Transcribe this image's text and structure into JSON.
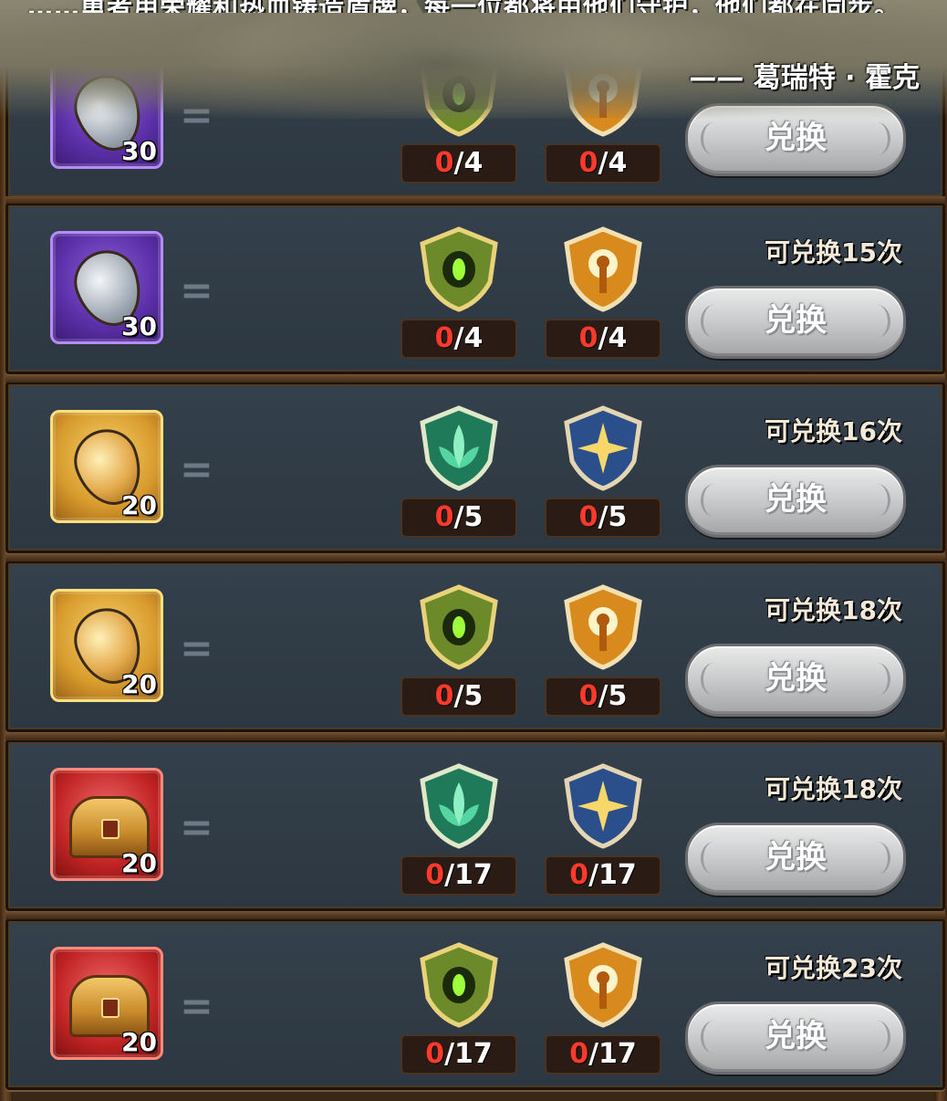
{
  "banner": {
    "quote_line": "……勇者用荣耀和热血铸造盾牌，每一位都将由他们守护，他们都在同步。",
    "quote_author": "—— 葛瑞特 · 霍克"
  },
  "rows": [
    {
      "reward_type": "purple-silver-gem",
      "reward_qty": "30",
      "item1": "0/4",
      "item1_have": "0",
      "item1_need": "/4",
      "item2_have": "0",
      "item2_need": "/4",
      "limit": "",
      "button": "兑换"
    },
    {
      "reward_type": "purple-silver-gem",
      "reward_qty": "30",
      "item1_have": "0",
      "item1_need": "/4",
      "item2_have": "0",
      "item2_need": "/4",
      "limit": "可兑换15次",
      "button": "兑换"
    },
    {
      "reward_type": "gold-gem",
      "reward_qty": "20",
      "item1_have": "0",
      "item1_need": "/5",
      "item2_have": "0",
      "item2_need": "/5",
      "limit": "可兑换16次",
      "button": "兑换"
    },
    {
      "reward_type": "gold-gem",
      "reward_qty": "20",
      "item1_have": "0",
      "item1_need": "/5",
      "item2_have": "0",
      "item2_need": "/5",
      "limit": "可兑换18次",
      "button": "兑换"
    },
    {
      "reward_type": "red-chest",
      "reward_qty": "20",
      "item1_have": "0",
      "item1_need": "/17",
      "item2_have": "0",
      "item2_need": "/17",
      "limit": "可兑换18次",
      "button": "兑换"
    },
    {
      "reward_type": "red-chest",
      "reward_qty": "20",
      "item1_have": "0",
      "item1_need": "/17",
      "item2_have": "0",
      "item2_need": "/17",
      "limit": "可兑换23次",
      "button": "兑换"
    }
  ],
  "icons": {
    "green_eye_shield": "green-eye-emblem-icon",
    "gold_keyhole_shield": "gold-keyhole-emblem-icon",
    "teal_leaf_shield": "teal-leaf-emblem-icon",
    "blue_star_shield": "blue-star-emblem-icon"
  },
  "colors": {
    "count_have": "#ff3a2a",
    "row_bg": "#2f3a44",
    "button": "#c9cacb"
  }
}
